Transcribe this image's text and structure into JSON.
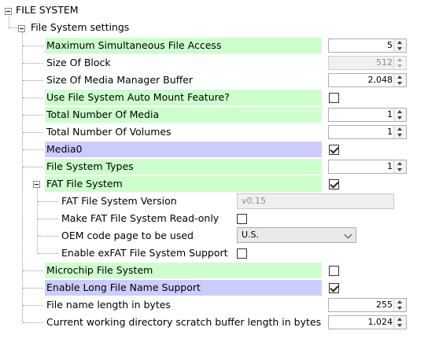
{
  "tree": {
    "root": {
      "label": "FILE SYSTEM"
    },
    "settings_group": {
      "label": "File System settings"
    },
    "items": {
      "max_file_access": {
        "label": "Maximum Simultaneous File Access",
        "value": "5"
      },
      "block_size": {
        "label": "Size Of Block",
        "value": "512"
      },
      "media_manager_buffer": {
        "label": "Size Of Media Manager Buffer",
        "value": "2,048"
      },
      "auto_mount": {
        "label": "Use File System Auto Mount Feature?",
        "checked": false
      },
      "total_media": {
        "label": "Total Number Of Media",
        "value": "1"
      },
      "total_volumes": {
        "label": "Total Number Of Volumes",
        "value": "1"
      },
      "media0": {
        "label": "Media0",
        "checked": true
      },
      "fs_types": {
        "label": "File System Types",
        "value": "1"
      },
      "fat_fs": {
        "label": "FAT File System",
        "checked": true
      },
      "fat_version": {
        "label": "FAT File System Version",
        "value": "v0.15"
      },
      "fat_readonly": {
        "label": "Make FAT File System Read-only",
        "checked": false
      },
      "oem_code_page": {
        "label": "OEM code page to be used",
        "value": "U.S."
      },
      "exfat_support": {
        "label": "Enable exFAT File System Support",
        "checked": false
      },
      "microchip_fs": {
        "label": "Microchip File System",
        "checked": false
      },
      "long_file_name": {
        "label": "Enable Long File Name Support",
        "checked": true
      },
      "file_name_length": {
        "label": "File name length in bytes",
        "value": "255"
      },
      "cwd_buffer": {
        "label": "Current working directory scratch buffer length in bytes",
        "value": "1,024"
      }
    }
  },
  "colors": {
    "highlight_green": "#ccffcc",
    "highlight_purple": "#ccccff"
  },
  "icons": {
    "expander": "collapse-minus-icon",
    "spinner_up": "spin-up-arrow-icon",
    "spinner_down": "spin-down-arrow-icon",
    "dropdown": "chevron-down-icon",
    "check": "checkmark-icon"
  }
}
